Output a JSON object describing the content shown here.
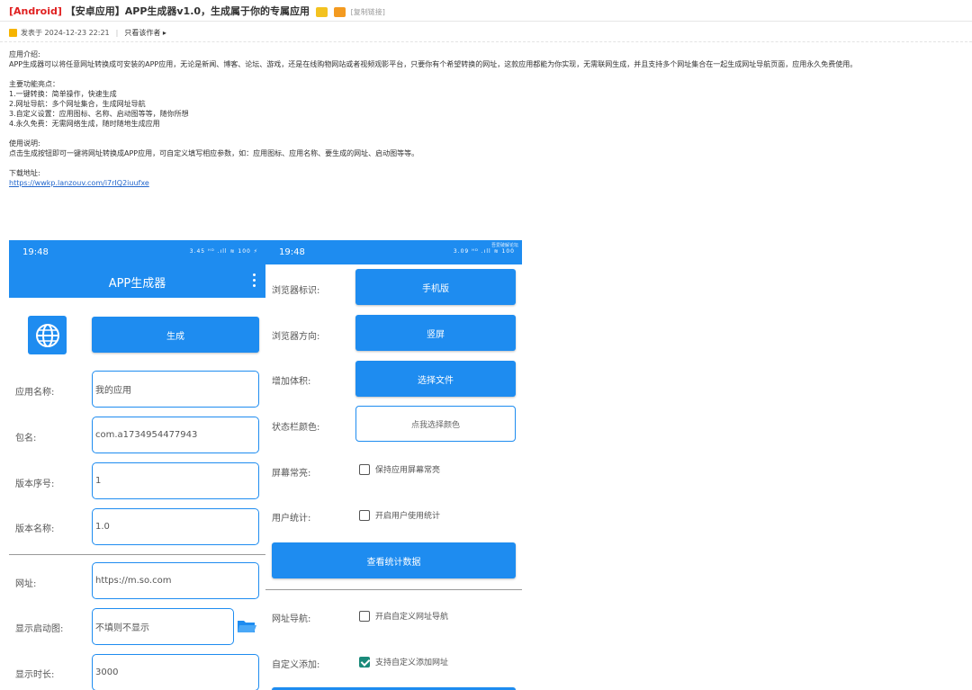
{
  "post": {
    "tag": "[Android]",
    "title": "【安卓应用】APP生成器v1.0，生成属于你的专属应用",
    "copy_link": "[复制链接]",
    "posted_at": "发表于 2024-12-23 22:21",
    "only_author": "只看该作者 ▸"
  },
  "content": {
    "intro_heading": "应用介绍:",
    "intro_text": "APP生成器可以将任意网址转换成可安装的APP应用，无论是新闻、博客、论坛、游戏，还是在线购物网站或者视频观影平台，只要你有个希望转换的网址，这款应用都能为你实现，无需联网生成，并且支持多个网址集合在一起生成网址导航页面，应用永久免费使用。",
    "features_heading": "主要功能亮点：",
    "features": [
      "1.一键转换：简单操作，快速生成",
      "2.网址导航：多个网址集合，生成网址导航",
      "3.自定义设置：应用图标、名称、启动图等等，随你所想",
      "4.永久免费：无需网络生成，随时随地生成应用"
    ],
    "usage_heading": "使用说明:",
    "usage_text": "点击生成按钮即可一键将网址转换成APP应用，可自定义填写相应参数，如：应用图标、应用名称、要生成的网址、启动图等等。",
    "download_heading": "下载地址:",
    "download_link": "https://wwkp.lanzouv.com/i7rIQ2iuufxe"
  },
  "phone1": {
    "time": "19:48",
    "status_icons": "3.45 ᴴᴰ .ıll ≋ 100 ⚡",
    "app_title": "APP生成器",
    "generate_btn": "生成",
    "fields": [
      {
        "label": "应用名称:",
        "value": "我的应用"
      },
      {
        "label": "包名:",
        "value": "com.a1734954477943"
      },
      {
        "label": "版本序号:",
        "value": "1"
      },
      {
        "label": "版本名称:",
        "value": "1.0"
      },
      {
        "label": "网址:",
        "value": "https://m.so.com"
      },
      {
        "label": "显示启动图:",
        "value": "不填则不显示"
      },
      {
        "label": "显示时长:",
        "value": "3000"
      }
    ]
  },
  "phone2": {
    "time": "19:48",
    "status_icons": "3.09 ᴴᴰ .ıll ≋ 100",
    "watermark": "吾爱破解论坛",
    "rows": [
      {
        "label": "浏览器标识:",
        "button": "手机版"
      },
      {
        "label": "浏览器方向:",
        "button": "竖屏"
      },
      {
        "label": "增加体积:",
        "button": "选择文件"
      },
      {
        "label": "状态栏颜色:",
        "button": "点我选择颜色"
      }
    ],
    "screen_on_label": "屏幕常亮:",
    "screen_on_text": "保持应用屏幕常亮",
    "stats_label": "用户统计:",
    "stats_text": "开启用户使用统计",
    "stats_btn": "查看统计数据",
    "nav_label": "网址导航:",
    "nav_text": "开启自定义网址导航",
    "custom_label": "自定义添加:",
    "custom_text": "支持自定义添加网址"
  },
  "colors": {
    "accent": "#1e8cf0",
    "tag": "#e02020",
    "check": "#1a8a7a"
  }
}
